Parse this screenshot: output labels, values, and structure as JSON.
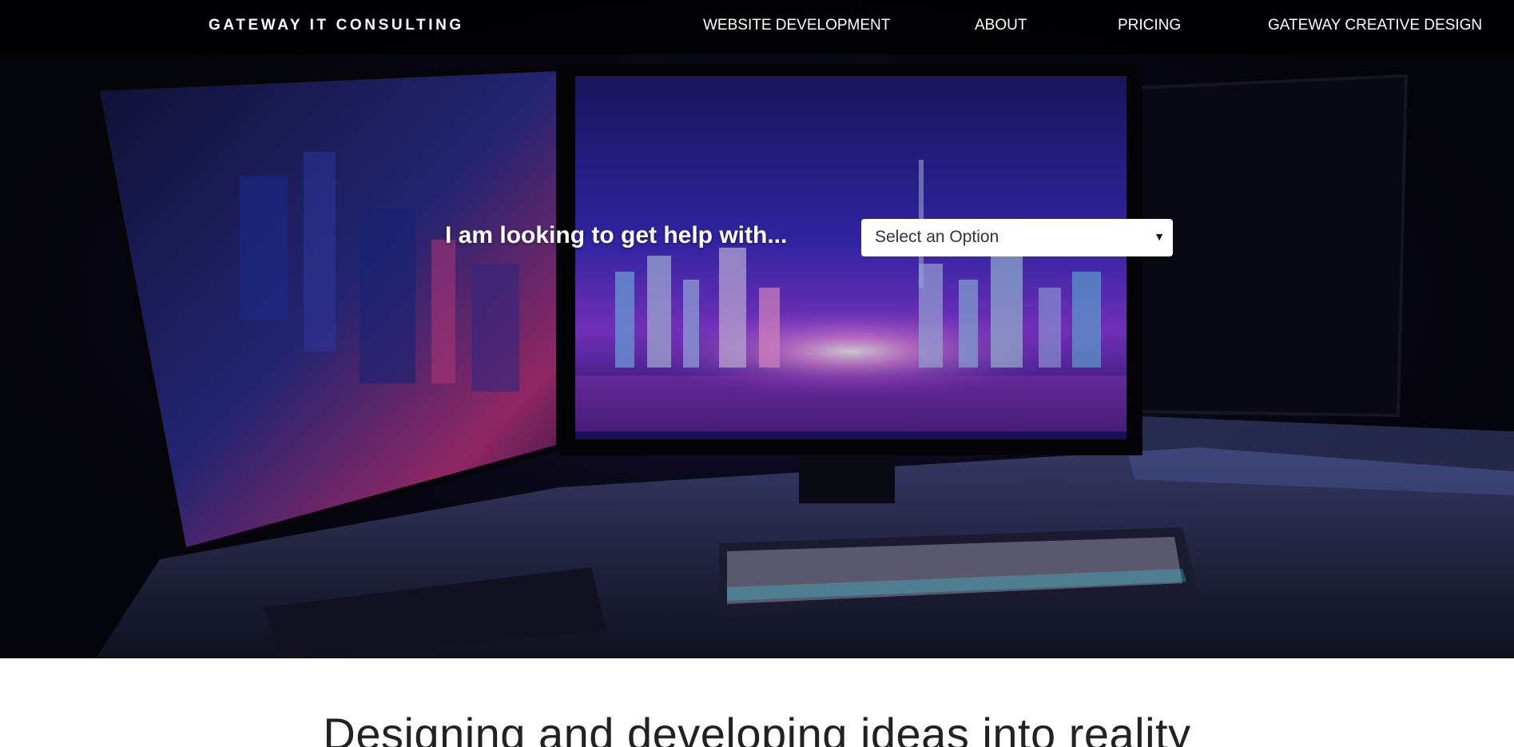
{
  "header": {
    "brand": "GATEWAY IT CONSULTING",
    "nav": [
      {
        "label": "WEBSITE DEVELOPMENT"
      },
      {
        "label": "ABOUT"
      },
      {
        "label": "PRICING"
      },
      {
        "label": "GATEWAY CREATIVE DESIGN"
      }
    ]
  },
  "hero": {
    "help_label": "I am looking to get help with...",
    "select": {
      "value": "Select an Option",
      "arrow_icon": "caret-down-icon"
    },
    "background": "dark desk with monitors showing neon city"
  },
  "main": {
    "headline": "Designing and developing ideas into reality"
  },
  "colors": {
    "nav_bg": "#000000",
    "nav_text": "#ffffff",
    "page_bg": "#ffffff",
    "headline": "#222222"
  }
}
